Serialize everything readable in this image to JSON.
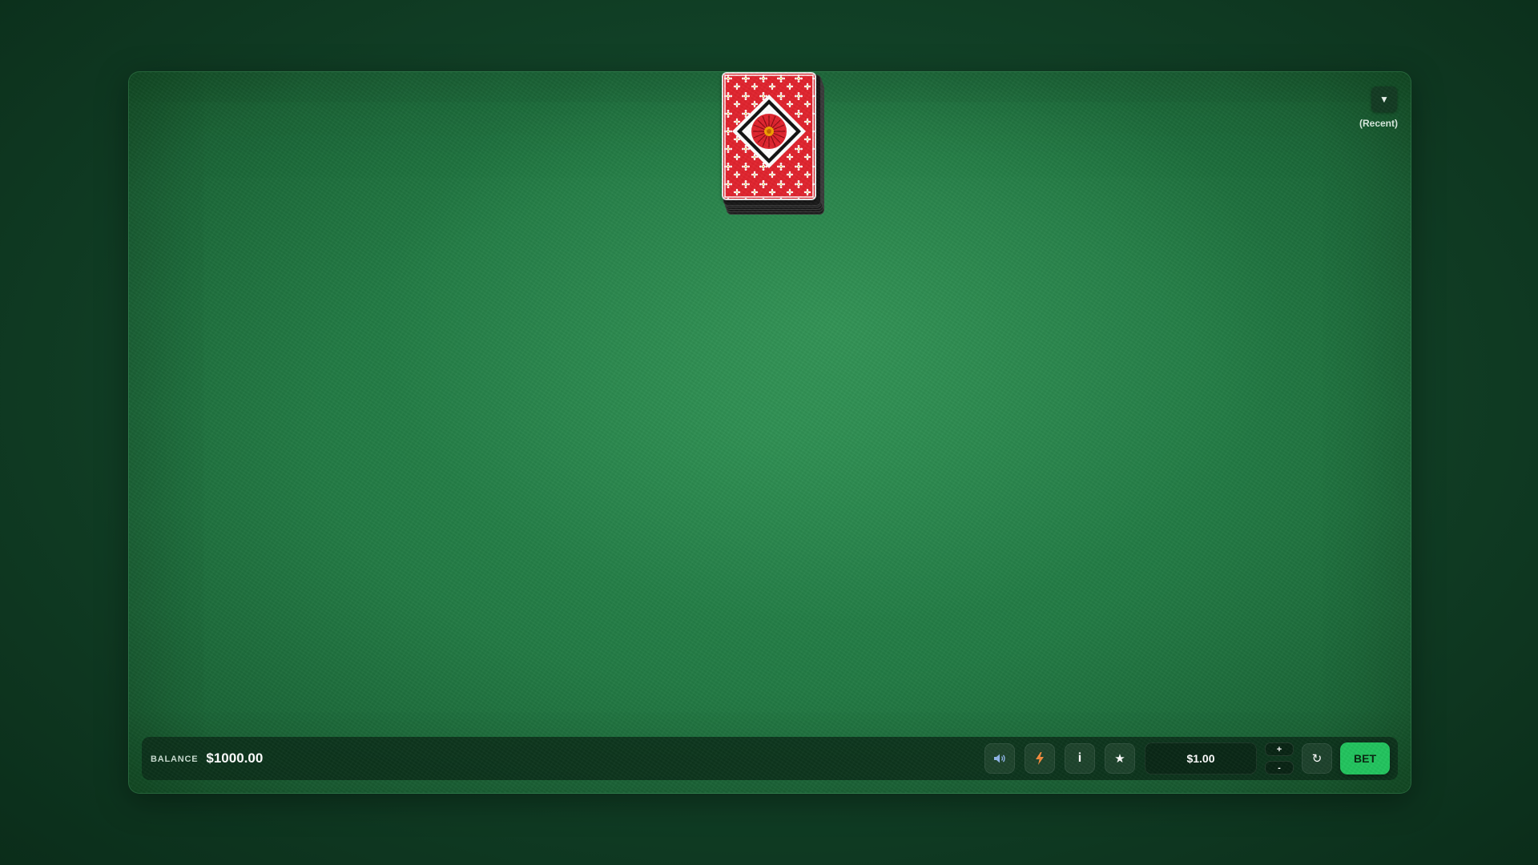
{
  "recent": {
    "toggle_icon": "▼",
    "label": "(Recent)"
  },
  "balance": {
    "label": "BALANCE",
    "value": "$1000.00"
  },
  "controls": {
    "sound_icon": "🔊",
    "turbo_icon": "⚡",
    "info_icon": "i",
    "favorite_icon": "★",
    "bet_amount": "$1.00",
    "increase_label": "+",
    "decrease_label": "-",
    "reset_icon": "↻",
    "bet_label": "BET"
  },
  "colors": {
    "table_felt": "#237a44",
    "bet_button": "#22c45e",
    "card_back_red": "#e0242e"
  }
}
